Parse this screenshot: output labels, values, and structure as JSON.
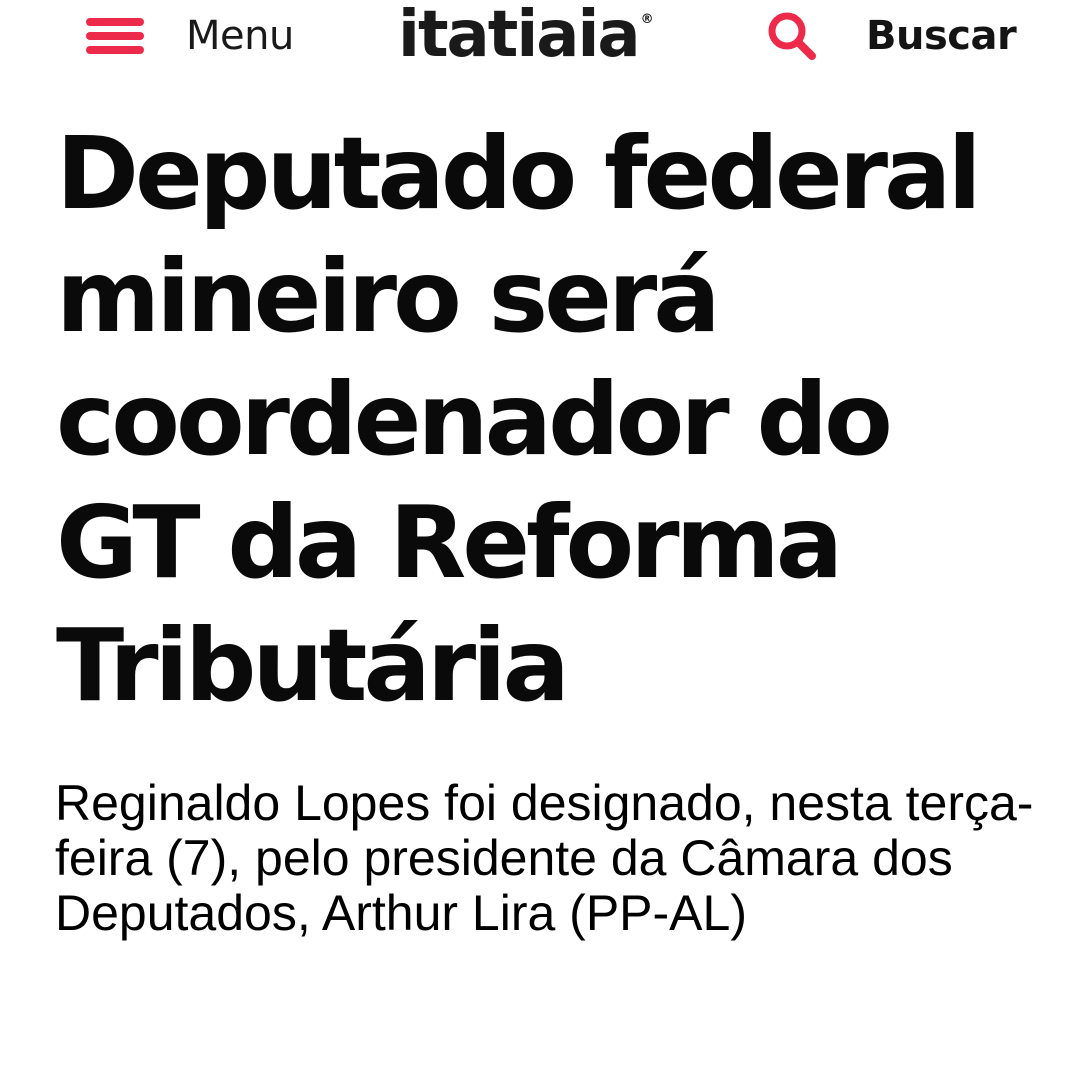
{
  "header": {
    "menu_label": "Menu",
    "menu_icon": "hamburger-icon",
    "logo_text": "itatiaia",
    "logo_mark": "®",
    "search_label": "Buscar",
    "search_icon": "search-icon"
  },
  "article": {
    "headline": "Deputado federal mineiro será coordenador do GT da Reforma Tributária",
    "subtitle": "Reginaldo Lopes foi designado, nesta terça-feira (7), pelo presidente da Câmara dos Deputados, Arthur Lira (PP-AL)"
  },
  "colors": {
    "accent": "#ee2a4b",
    "text": "#0a0a0a",
    "background": "#ffffff"
  }
}
